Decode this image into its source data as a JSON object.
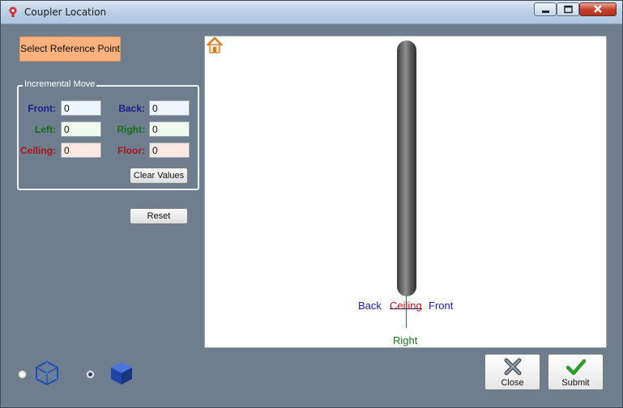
{
  "window": {
    "title": "Coupler Location",
    "controls": {
      "minimize": "minimize-icon",
      "maximize": "maximize-icon",
      "close": "close-icon"
    }
  },
  "select_reference_button": "Select Reference Point",
  "incremental_move": {
    "title": "Incremental Move",
    "front": {
      "label": "Front:",
      "value": "0"
    },
    "back": {
      "label": "Back:",
      "value": "0"
    },
    "left": {
      "label": "Left:",
      "value": "0"
    },
    "right": {
      "label": "Right:",
      "value": "0"
    },
    "ceiling": {
      "label": "Ceiling:",
      "value": "0"
    },
    "floor": {
      "label": "Floor:",
      "value": "0"
    },
    "clear_button": "Clear Values"
  },
  "reset_button": "Reset",
  "viewport": {
    "home_icon": "home-icon",
    "axis_labels": {
      "back": "Back",
      "front": "Front",
      "ceiling": "Ceiling",
      "right": "Right"
    }
  },
  "view_mode": {
    "options": [
      "wireframe-cube-icon",
      "solid-cube-icon"
    ],
    "selected": "solid-cube-icon"
  },
  "actions": {
    "close": "Close",
    "submit": "Submit"
  },
  "colors": {
    "background": "#6e7e8e",
    "reference_button": "#f9b27d",
    "blue_labels": "#1c1e8e",
    "green_labels": "#1a6b1a",
    "red_labels": "#b0101a"
  }
}
